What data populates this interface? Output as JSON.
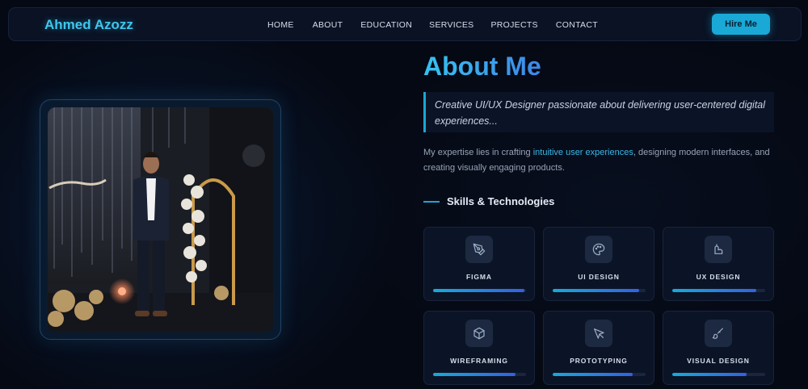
{
  "brand": "Ahmed Azozz",
  "nav": {
    "items": [
      {
        "label": "HOME"
      },
      {
        "label": "ABOUT"
      },
      {
        "label": "EDUCATION"
      },
      {
        "label": "SERVICES"
      },
      {
        "label": "PROJECTS"
      },
      {
        "label": "CONTACT"
      }
    ],
    "cta": "Hire Me"
  },
  "about": {
    "title": "About Me",
    "quote": "Creative UI/UX Designer passionate about delivering user-centered digital experiences...",
    "desc_before": "My expertise lies in crafting ",
    "desc_highlight": "intuitive user experiences",
    "desc_after": ", designing modern interfaces, and creating visually engaging products."
  },
  "skills": {
    "heading": "Skills & Technologies",
    "items": [
      {
        "label": "FIGMA",
        "icon": "pen-tool-icon",
        "level": 0.98
      },
      {
        "label": "UI DESIGN",
        "icon": "palette-icon",
        "level": 0.93
      },
      {
        "label": "UX DESIGN",
        "icon": "user-experience-icon",
        "level": 0.9
      },
      {
        "label": "WIREFRAMING",
        "icon": "cube-icon",
        "level": 0.89
      },
      {
        "label": "PROTOTYPING",
        "icon": "cursor-pointer-icon",
        "level": 0.86
      },
      {
        "label": "VISUAL DESIGN",
        "icon": "brush-icon",
        "level": 0.8
      }
    ]
  },
  "colors": {
    "accent": "#1aa9d6",
    "background": "#050914",
    "card": "#0b1426"
  }
}
